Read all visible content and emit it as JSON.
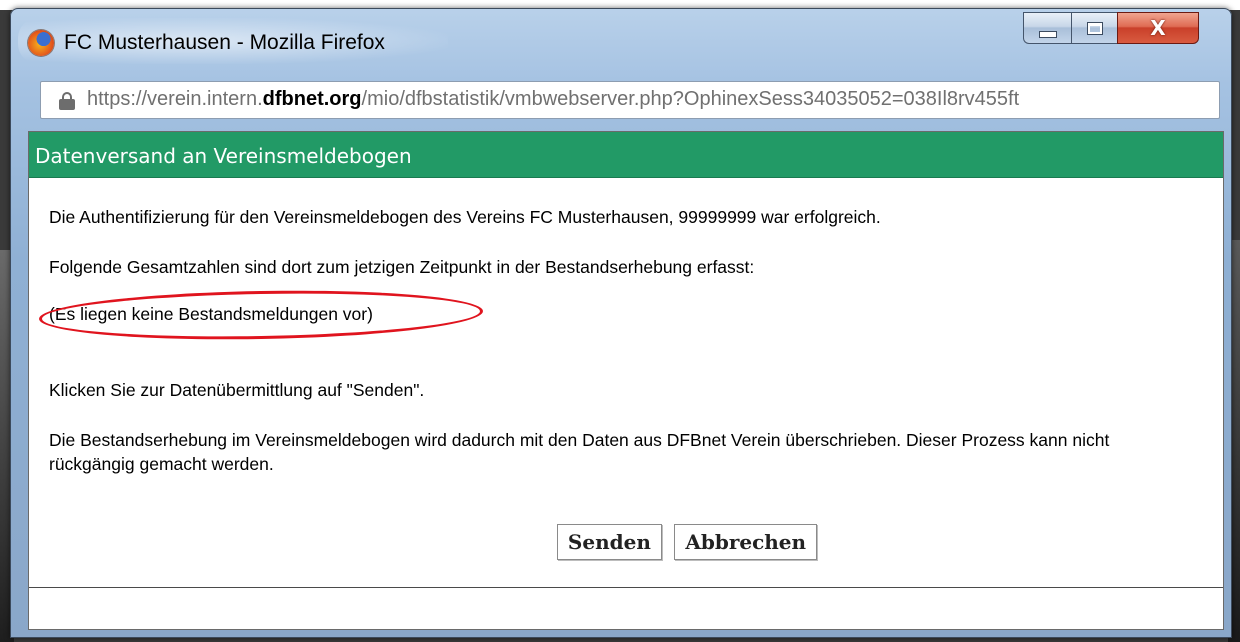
{
  "window": {
    "title": "FC Musterhausen - Mozilla Firefox",
    "controls": {
      "minimize": "minimize",
      "maximize": "maximize",
      "close": "X"
    }
  },
  "urlbar": {
    "url_prefix": "https://verein.intern.",
    "url_domain": "dfbnet.org",
    "url_suffix": "/mio/dfbstatistik/vmbwebserver.php?OphinexSess34035052=038Il8rv455ft"
  },
  "dialog": {
    "title": "Datenversand an Vereinsmeldebogen",
    "line1": "Die Authentifizierung für den Vereinsmeldebogen des Vereins FC Musterhausen, 99999999  war erfolgreich.",
    "line2": "Folgende Gesamtzahlen sind dort zum jetzigen Zeitpunkt in der Bestandserhebung erfasst:",
    "line3": "(Es liegen keine Bestandsmeldungen vor)",
    "line4": "Klicken Sie zur Datenübermittlung auf \"Senden\".",
    "line5": "Die Bestandserhebung im Vereinsmeldebogen wird dadurch mit den Daten aus DFBnet Verein überschrieben. Dieser Prozess kann nicht rückgängig gemacht werden.",
    "send_label": "Senden",
    "cancel_label": "Abbrechen"
  },
  "colors": {
    "header_green": "#229a66",
    "highlight_red": "#e0141e"
  },
  "icons": {
    "app": "firefox-icon",
    "lock": "lock-icon"
  }
}
